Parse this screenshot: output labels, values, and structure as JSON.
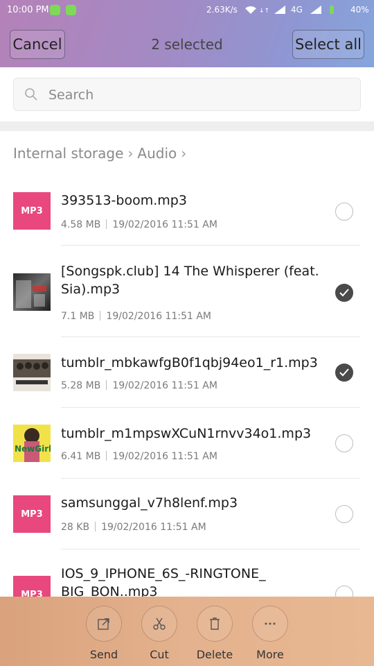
{
  "status_bar": {
    "time": "10:00 PM",
    "speed": "2.63K/s",
    "network": "4G",
    "battery": "40%"
  },
  "header": {
    "cancel_label": "Cancel",
    "title": "2 selected",
    "select_all_label": "Select all"
  },
  "search": {
    "placeholder": "Search"
  },
  "breadcrumb": {
    "items": [
      "Internal storage",
      "Audio"
    ]
  },
  "files": [
    {
      "name": "393513-boom.mp3",
      "size": "4.58 MB",
      "date": "19/02/2016 11:51 AM",
      "thumb": "MP3",
      "selected": false
    },
    {
      "name": "[Songspk.club] 14 The Whisperer (feat. Sia).mp3",
      "size": "7.1 MB",
      "date": "19/02/2016 11:51 AM",
      "thumb": "album-art-dark",
      "selected": true
    },
    {
      "name": "tumblr_mbkawfgB0f1qbj94eo1_r1.mp3",
      "size": "5.28 MB",
      "date": "19/02/2016 11:51 AM",
      "thumb": "album-art-band",
      "selected": true
    },
    {
      "name": "tumblr_m1mpswXCuN1rnvv34o1.mp3",
      "size": "6.41 MB",
      "date": "19/02/2016 11:51 AM",
      "thumb": "album-art-newgirl",
      "thumb_text": "NewGirl",
      "selected": false
    },
    {
      "name": "samsunggal_v7h8lenf.mp3",
      "size": "28 KB",
      "date": "19/02/2016 11:51 AM",
      "thumb": "MP3",
      "selected": false
    },
    {
      "name": "IOS_9_IPHONE_6S_-RINGTONE_BIG_BON..mp3",
      "size": "",
      "date": "",
      "thumb": "MP3",
      "selected": false
    }
  ],
  "actions": [
    {
      "label": "Send",
      "icon": "send-icon"
    },
    {
      "label": "Cut",
      "icon": "scissors-icon"
    },
    {
      "label": "Delete",
      "icon": "trash-icon"
    },
    {
      "label": "More",
      "icon": "more-dots-icon"
    }
  ],
  "colors": {
    "mp3_badge": "#e8487d",
    "check_selected": "#4a4a4a",
    "header_gradient_start": "#b482b8",
    "header_gradient_end": "#86a5dc",
    "bottom_bar": "#e4b28e"
  }
}
